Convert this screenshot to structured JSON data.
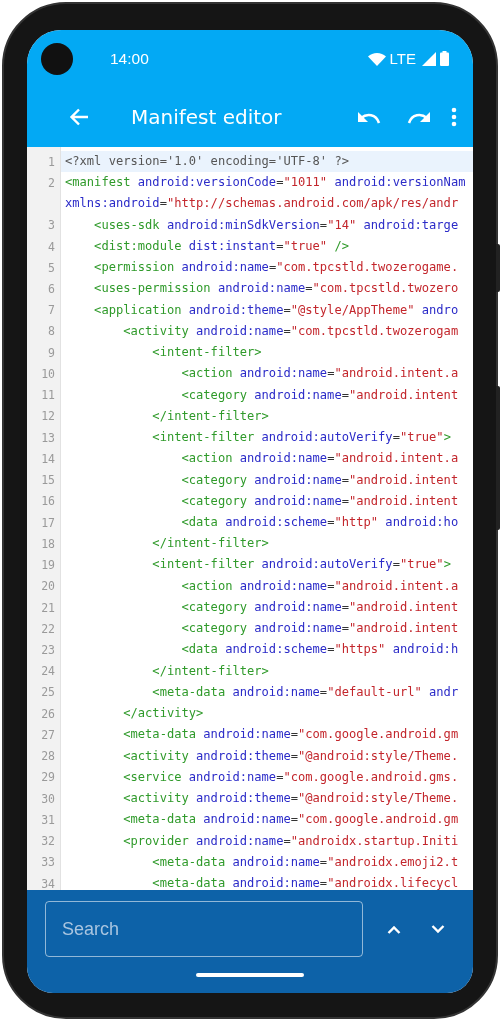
{
  "status_bar": {
    "time": "14:00",
    "network": "LTE"
  },
  "toolbar": {
    "title": "Manifest editor"
  },
  "editor": {
    "lines": [
      {
        "number": "1",
        "selected": true,
        "segments": [
          {
            "kind": "decl",
            "text": "<?xml version='1.0' encoding='UTF-8' ?>"
          }
        ]
      },
      {
        "number": "2",
        "selected": false,
        "segments": [
          {
            "kind": "tag",
            "text": "<manifest"
          },
          {
            "kind": "attr",
            "text": " android:versionCode"
          },
          {
            "kind": "punct",
            "text": "="
          },
          {
            "kind": "value",
            "text": "\"1011\""
          },
          {
            "kind": "attr",
            "text": " android:versionNam"
          }
        ],
        "continuation": [
          {
            "kind": "attr",
            "text": "xmlns:android"
          },
          {
            "kind": "punct",
            "text": "="
          },
          {
            "kind": "value",
            "text": "\"http://schemas.android.com/apk/res/andr"
          }
        ]
      },
      {
        "number": "3",
        "selected": false,
        "segments": [
          {
            "kind": "tag",
            "text": "    <uses-sdk"
          },
          {
            "kind": "attr",
            "text": " android:minSdkVersion"
          },
          {
            "kind": "punct",
            "text": "="
          },
          {
            "kind": "value",
            "text": "\"14\""
          },
          {
            "kind": "attr",
            "text": " android:targe"
          }
        ]
      },
      {
        "number": "4",
        "selected": false,
        "segments": [
          {
            "kind": "tag",
            "text": "    <dist:module"
          },
          {
            "kind": "attr",
            "text": " dist:instant"
          },
          {
            "kind": "punct",
            "text": "="
          },
          {
            "kind": "value",
            "text": "\"true\""
          },
          {
            "kind": "tag",
            "text": " />"
          }
        ]
      },
      {
        "number": "5",
        "selected": false,
        "segments": [
          {
            "kind": "tag",
            "text": "    <permission"
          },
          {
            "kind": "attr",
            "text": " android:name"
          },
          {
            "kind": "punct",
            "text": "="
          },
          {
            "kind": "value",
            "text": "\"com.tpcstld.twozerogame."
          }
        ]
      },
      {
        "number": "6",
        "selected": false,
        "segments": [
          {
            "kind": "tag",
            "text": "    <uses-permission"
          },
          {
            "kind": "attr",
            "text": " android:name"
          },
          {
            "kind": "punct",
            "text": "="
          },
          {
            "kind": "value",
            "text": "\"com.tpcstld.twozero"
          }
        ]
      },
      {
        "number": "7",
        "selected": false,
        "segments": [
          {
            "kind": "tag",
            "text": "    <application"
          },
          {
            "kind": "attr",
            "text": " android:theme"
          },
          {
            "kind": "punct",
            "text": "="
          },
          {
            "kind": "value",
            "text": "\"@style/AppTheme\""
          },
          {
            "kind": "attr",
            "text": " andro"
          }
        ]
      },
      {
        "number": "8",
        "selected": false,
        "segments": [
          {
            "kind": "tag",
            "text": "        <activity"
          },
          {
            "kind": "attr",
            "text": " android:name"
          },
          {
            "kind": "punct",
            "text": "="
          },
          {
            "kind": "value",
            "text": "\"com.tpcstld.twozerogam"
          }
        ]
      },
      {
        "number": "9",
        "selected": false,
        "segments": [
          {
            "kind": "tag",
            "text": "            <intent-filter>"
          }
        ]
      },
      {
        "number": "10",
        "selected": false,
        "segments": [
          {
            "kind": "tag",
            "text": "                <action"
          },
          {
            "kind": "attr",
            "text": " android:name"
          },
          {
            "kind": "punct",
            "text": "="
          },
          {
            "kind": "value",
            "text": "\"android.intent.a"
          }
        ]
      },
      {
        "number": "11",
        "selected": false,
        "segments": [
          {
            "kind": "tag",
            "text": "                <category"
          },
          {
            "kind": "attr",
            "text": " android:name"
          },
          {
            "kind": "punct",
            "text": "="
          },
          {
            "kind": "value",
            "text": "\"android.intent"
          }
        ]
      },
      {
        "number": "12",
        "selected": false,
        "segments": [
          {
            "kind": "tag",
            "text": "            </intent-filter>"
          }
        ]
      },
      {
        "number": "13",
        "selected": false,
        "segments": [
          {
            "kind": "tag",
            "text": "            <intent-filter"
          },
          {
            "kind": "attr",
            "text": " android:autoVerify"
          },
          {
            "kind": "punct",
            "text": "="
          },
          {
            "kind": "value",
            "text": "\"true\""
          },
          {
            "kind": "tag",
            "text": ">"
          }
        ]
      },
      {
        "number": "14",
        "selected": false,
        "segments": [
          {
            "kind": "tag",
            "text": "                <action"
          },
          {
            "kind": "attr",
            "text": " android:name"
          },
          {
            "kind": "punct",
            "text": "="
          },
          {
            "kind": "value",
            "text": "\"android.intent.a"
          }
        ]
      },
      {
        "number": "15",
        "selected": false,
        "segments": [
          {
            "kind": "tag",
            "text": "                <category"
          },
          {
            "kind": "attr",
            "text": " android:name"
          },
          {
            "kind": "punct",
            "text": "="
          },
          {
            "kind": "value",
            "text": "\"android.intent"
          }
        ]
      },
      {
        "number": "16",
        "selected": false,
        "segments": [
          {
            "kind": "tag",
            "text": "                <category"
          },
          {
            "kind": "attr",
            "text": " android:name"
          },
          {
            "kind": "punct",
            "text": "="
          },
          {
            "kind": "value",
            "text": "\"android.intent"
          }
        ]
      },
      {
        "number": "17",
        "selected": false,
        "segments": [
          {
            "kind": "tag",
            "text": "                <data"
          },
          {
            "kind": "attr",
            "text": " android:scheme"
          },
          {
            "kind": "punct",
            "text": "="
          },
          {
            "kind": "value",
            "text": "\"http\""
          },
          {
            "kind": "attr",
            "text": " android:ho"
          }
        ]
      },
      {
        "number": "18",
        "selected": false,
        "segments": [
          {
            "kind": "tag",
            "text": "            </intent-filter>"
          }
        ]
      },
      {
        "number": "19",
        "selected": false,
        "segments": [
          {
            "kind": "tag",
            "text": "            <intent-filter"
          },
          {
            "kind": "attr",
            "text": " android:autoVerify"
          },
          {
            "kind": "punct",
            "text": "="
          },
          {
            "kind": "value",
            "text": "\"true\""
          },
          {
            "kind": "tag",
            "text": ">"
          }
        ]
      },
      {
        "number": "20",
        "selected": false,
        "segments": [
          {
            "kind": "tag",
            "text": "                <action"
          },
          {
            "kind": "attr",
            "text": " android:name"
          },
          {
            "kind": "punct",
            "text": "="
          },
          {
            "kind": "value",
            "text": "\"android.intent.a"
          }
        ]
      },
      {
        "number": "21",
        "selected": false,
        "segments": [
          {
            "kind": "tag",
            "text": "                <category"
          },
          {
            "kind": "attr",
            "text": " android:name"
          },
          {
            "kind": "punct",
            "text": "="
          },
          {
            "kind": "value",
            "text": "\"android.intent"
          }
        ]
      },
      {
        "number": "22",
        "selected": false,
        "segments": [
          {
            "kind": "tag",
            "text": "                <category"
          },
          {
            "kind": "attr",
            "text": " android:name"
          },
          {
            "kind": "punct",
            "text": "="
          },
          {
            "kind": "value",
            "text": "\"android.intent"
          }
        ]
      },
      {
        "number": "23",
        "selected": false,
        "segments": [
          {
            "kind": "tag",
            "text": "                <data"
          },
          {
            "kind": "attr",
            "text": " android:scheme"
          },
          {
            "kind": "punct",
            "text": "="
          },
          {
            "kind": "value",
            "text": "\"https\""
          },
          {
            "kind": "attr",
            "text": " android:h"
          }
        ]
      },
      {
        "number": "24",
        "selected": false,
        "segments": [
          {
            "kind": "tag",
            "text": "            </intent-filter>"
          }
        ]
      },
      {
        "number": "25",
        "selected": false,
        "segments": [
          {
            "kind": "tag",
            "text": "            <meta-data"
          },
          {
            "kind": "attr",
            "text": " android:name"
          },
          {
            "kind": "punct",
            "text": "="
          },
          {
            "kind": "value",
            "text": "\"default-url\""
          },
          {
            "kind": "attr",
            "text": " andr"
          }
        ]
      },
      {
        "number": "26",
        "selected": false,
        "segments": [
          {
            "kind": "tag",
            "text": "        </activity>"
          }
        ]
      },
      {
        "number": "27",
        "selected": false,
        "segments": [
          {
            "kind": "tag",
            "text": "        <meta-data"
          },
          {
            "kind": "attr",
            "text": " android:name"
          },
          {
            "kind": "punct",
            "text": "="
          },
          {
            "kind": "value",
            "text": "\"com.google.android.gm"
          }
        ]
      },
      {
        "number": "28",
        "selected": false,
        "segments": [
          {
            "kind": "tag",
            "text": "        <activity"
          },
          {
            "kind": "attr",
            "text": " android:theme"
          },
          {
            "kind": "punct",
            "text": "="
          },
          {
            "kind": "value",
            "text": "\"@android:style/Theme."
          }
        ]
      },
      {
        "number": "29",
        "selected": false,
        "segments": [
          {
            "kind": "tag",
            "text": "        <service"
          },
          {
            "kind": "attr",
            "text": " android:name"
          },
          {
            "kind": "punct",
            "text": "="
          },
          {
            "kind": "value",
            "text": "\"com.google.android.gms."
          }
        ]
      },
      {
        "number": "30",
        "selected": false,
        "segments": [
          {
            "kind": "tag",
            "text": "        <activity"
          },
          {
            "kind": "attr",
            "text": " android:theme"
          },
          {
            "kind": "punct",
            "text": "="
          },
          {
            "kind": "value",
            "text": "\"@android:style/Theme."
          }
        ]
      },
      {
        "number": "31",
        "selected": false,
        "segments": [
          {
            "kind": "tag",
            "text": "        <meta-data"
          },
          {
            "kind": "attr",
            "text": " android:name"
          },
          {
            "kind": "punct",
            "text": "="
          },
          {
            "kind": "value",
            "text": "\"com.google.android.gm"
          }
        ]
      },
      {
        "number": "32",
        "selected": false,
        "segments": [
          {
            "kind": "tag",
            "text": "        <provider"
          },
          {
            "kind": "attr",
            "text": " android:name"
          },
          {
            "kind": "punct",
            "text": "="
          },
          {
            "kind": "value",
            "text": "\"androidx.startup.Initi"
          }
        ]
      },
      {
        "number": "33",
        "selected": false,
        "segments": [
          {
            "kind": "tag",
            "text": "            <meta-data"
          },
          {
            "kind": "attr",
            "text": " android:name"
          },
          {
            "kind": "punct",
            "text": "="
          },
          {
            "kind": "value",
            "text": "\"androidx.emoji2.t"
          }
        ]
      },
      {
        "number": "34",
        "selected": false,
        "segments": [
          {
            "kind": "tag",
            "text": "            <meta-data"
          },
          {
            "kind": "attr",
            "text": " android:name"
          },
          {
            "kind": "punct",
            "text": "="
          },
          {
            "kind": "value",
            "text": "\"androidx.lifecycl"
          }
        ]
      }
    ]
  },
  "search": {
    "placeholder": "Search"
  }
}
